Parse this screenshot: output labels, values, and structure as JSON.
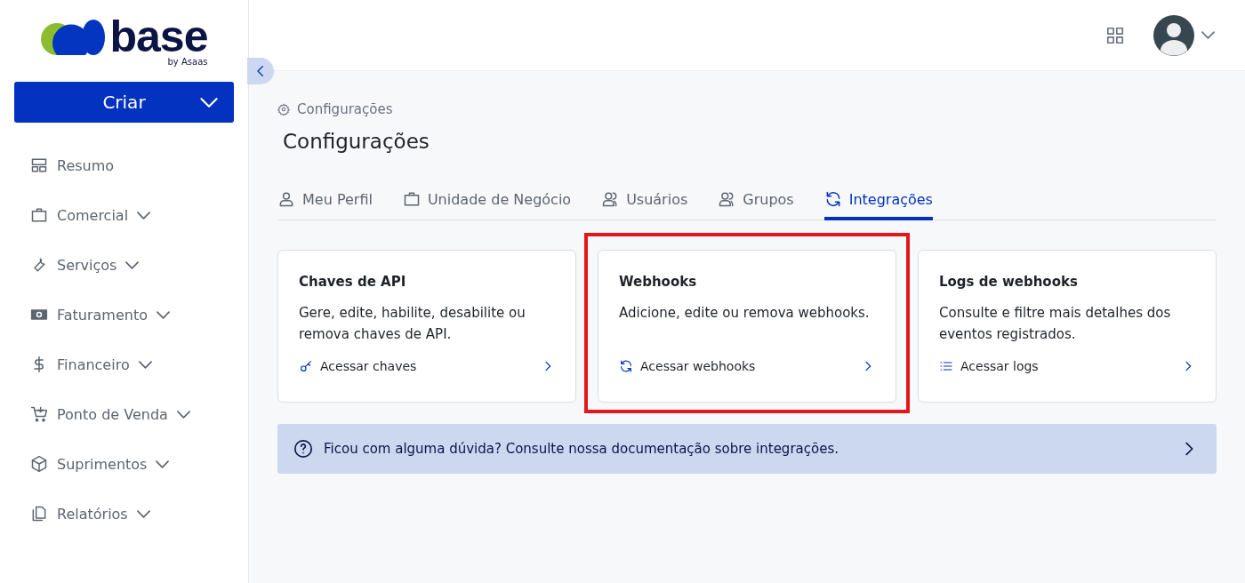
{
  "sidebar": {
    "logo": {
      "wordmark": "base",
      "tagline": "by Asaas"
    },
    "create_button": "Criar",
    "items": [
      {
        "label": "Resumo",
        "expandable": false
      },
      {
        "label": "Comercial",
        "expandable": true
      },
      {
        "label": "Serviços",
        "expandable": true
      },
      {
        "label": "Faturamento",
        "expandable": true
      },
      {
        "label": "Financeiro",
        "expandable": true
      },
      {
        "label": "Ponto de Venda",
        "expandable": true
      },
      {
        "label": "Suprimentos",
        "expandable": true
      },
      {
        "label": "Relatórios",
        "expandable": true
      }
    ]
  },
  "breadcrumb": "Configurações",
  "title": "Configurações",
  "tabs": [
    {
      "label": "Meu Perfil",
      "selected": false
    },
    {
      "label": "Unidade de Negócio",
      "selected": false
    },
    {
      "label": "Usuários",
      "selected": false
    },
    {
      "label": "Grupos",
      "selected": false
    },
    {
      "label": "Integrações",
      "selected": true
    }
  ],
  "cards": [
    {
      "title": "Chaves de API",
      "description": "Gere, edite, habilite, desabilite ou remova chaves de API.",
      "link": "Acessar chaves",
      "highlighted": false
    },
    {
      "title": "Webhooks",
      "description": "Adicione, edite ou remova webhooks.",
      "link": "Acessar webhooks",
      "highlighted": true
    },
    {
      "title": "Logs de webhooks",
      "description": "Consulte e filtre mais detalhes dos eventos registrados.",
      "link": "Acessar logs",
      "highlighted": false
    }
  ],
  "help_banner": "Ficou com alguma dúvida? Consulte nossa documentação sobre integrações."
}
